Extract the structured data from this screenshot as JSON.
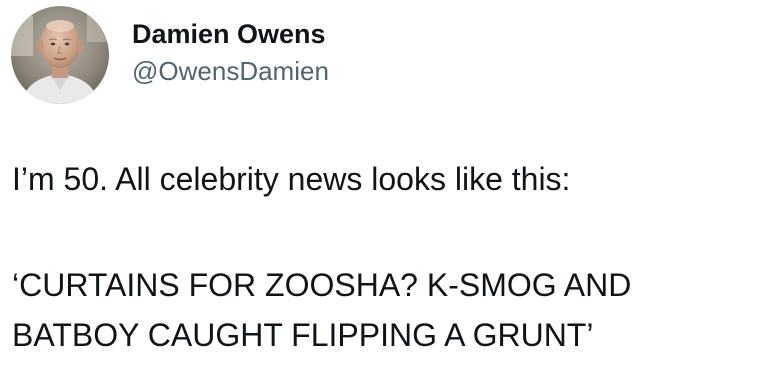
{
  "tweet": {
    "author": {
      "display_name": "Damien Owens",
      "handle": "@OwensDamien",
      "avatar_icon": "user-avatar-photo"
    },
    "text_lines": [
      "I’m 50. All celebrity news looks like this:",
      "‘CURTAINS FOR ZOOSHA? K-SMOG AND",
      "BATBOY CAUGHT FLIPPING A GRUNT’"
    ]
  },
  "colors": {
    "background": "#ffffff",
    "primary_text": "#0f1419",
    "secondary_text": "#536471"
  }
}
